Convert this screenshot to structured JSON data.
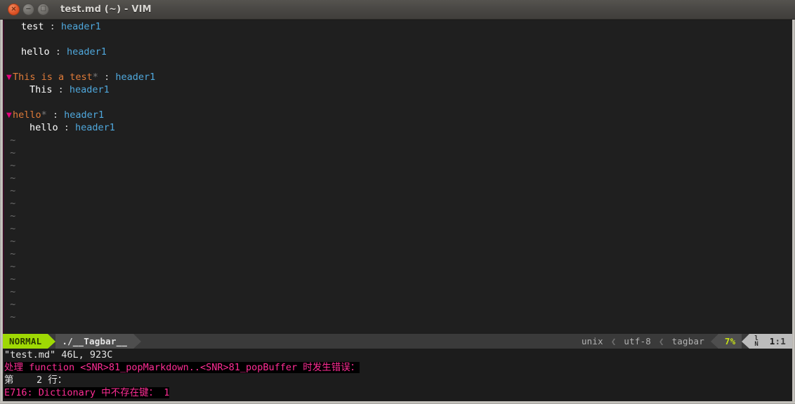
{
  "window": {
    "title": "test.md (~) - VIM",
    "buttons": [
      {
        "name": "close",
        "glyph": "×"
      },
      {
        "name": "minimize",
        "glyph": "−"
      },
      {
        "name": "maximize",
        "glyph": "□"
      }
    ]
  },
  "tagbar": {
    "rows": [
      {
        "fold": "",
        "indent": 1,
        "name": "test",
        "star": "",
        "sep": " : ",
        "scope": "header1"
      },
      {
        "fold": "",
        "indent": 0,
        "name": "",
        "star": "",
        "sep": "",
        "scope": ""
      },
      {
        "fold": "",
        "indent": 1,
        "name": "hello",
        "star": "",
        "sep": " : ",
        "scope": "header1"
      },
      {
        "fold": "",
        "indent": 0,
        "name": "",
        "star": "",
        "sep": "",
        "scope": ""
      },
      {
        "fold": "▼",
        "indent": 0,
        "name": "This is a test",
        "star": "*",
        "sep": " : ",
        "scope": "header1"
      },
      {
        "fold": "",
        "indent": 2,
        "name": "This",
        "star": "",
        "sep": " : ",
        "scope": "header1"
      },
      {
        "fold": "",
        "indent": 0,
        "name": "",
        "star": "",
        "sep": "",
        "scope": ""
      },
      {
        "fold": "▼",
        "indent": 0,
        "name": "hello",
        "star": "*",
        "sep": " : ",
        "scope": "header1"
      },
      {
        "fold": "",
        "indent": 2,
        "name": "hello",
        "star": "",
        "sep": " : ",
        "scope": "header1"
      }
    ],
    "empty_marker": "~",
    "empty_count": 15
  },
  "statusline": {
    "mode": "NORMAL",
    "file": "./__Tagbar__",
    "fileformat": "unix",
    "encoding": "utf-8",
    "filetype": "tagbar",
    "percent": "7%",
    "line_icon_top": "l",
    "line_icon_bottom": "N",
    "position_line": "1",
    "position_sep": ":",
    "position_col": "1",
    "chevron": "❮"
  },
  "messages": [
    {
      "text": "\"test.md\" 46L, 923C",
      "type": "plain"
    },
    {
      "text": "处理 function <SNR>81_popMarkdown..<SNR>81_popBuffer 时发生错误：",
      "type": "error"
    },
    {
      "text": "第    2 行：",
      "type": "plain"
    },
    {
      "text": "E716: Dictionary 中不存在键： 1",
      "type": "error"
    }
  ],
  "colors": {
    "tag_name": "#e07b39",
    "scope": "#4fa8dd",
    "fold_marker": "#e6007e",
    "mode_bg": "#9fd904",
    "error_text": "#ff2d95",
    "percent_text": "#c6e016",
    "background": "#1f1f1f"
  }
}
